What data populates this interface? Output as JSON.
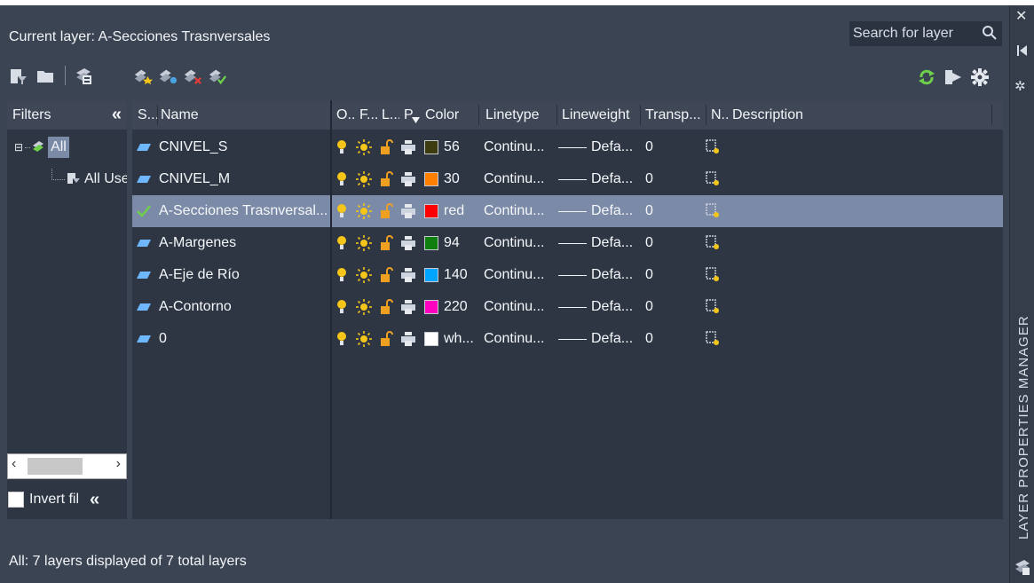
{
  "window": {
    "title": "LAYER PROPERTIES MANAGER",
    "current_layer_label": "Current layer: A-Secciones Trasnversales",
    "search_placeholder": "Search for layer"
  },
  "toolbar": {
    "left_icons": [
      "new-property-filter-icon",
      "new-group-filter-icon",
      "layer-states-manager-icon"
    ],
    "layer_icons": [
      "new-layer-icon",
      "new-layer-vp-frozen-icon",
      "delete-layer-icon",
      "set-current-icon"
    ],
    "right_icons": [
      "refresh-icon",
      "layer-settings-transfer-icon",
      "settings-gear-icon"
    ]
  },
  "filters": {
    "header": "Filters",
    "collapse_glyph": "«",
    "tree": [
      {
        "label": "All",
        "expand_glyph": "⊟",
        "selected": true
      },
      {
        "label": "All Used Layers"
      }
    ],
    "invert_label": "Invert fil",
    "invert_collapse": "«",
    "scroll_left": "‹",
    "scroll_right": "›"
  },
  "grid": {
    "columns": {
      "status": "S...",
      "name": "Name",
      "on": "O..",
      "freeze": "F...",
      "lock": "L...",
      "plot": "P",
      "color": "Color",
      "linetype": "Linetype",
      "lineweight": "Lineweight",
      "transparency": "Transp...",
      "new_vp_freeze": "N..",
      "description": "Description"
    },
    "rows": [
      {
        "name": "CNIVEL_S",
        "current": false,
        "color_label": "56",
        "color_hex": "#3c3c0e",
        "linetype": "Continu...",
        "lineweight": "Defa...",
        "transparency": "0"
      },
      {
        "name": "CNIVEL_M",
        "current": false,
        "color_label": "30",
        "color_hex": "#ff7f00",
        "linetype": "Continu...",
        "lineweight": "Defa...",
        "transparency": "0"
      },
      {
        "name": "A-Secciones Trasnversal...",
        "current": true,
        "color_label": "red",
        "color_hex": "#ff0000",
        "linetype": "Continu...",
        "lineweight": "Defa...",
        "transparency": "0"
      },
      {
        "name": "A-Margenes",
        "current": false,
        "color_label": "94",
        "color_hex": "#0f7f0f",
        "linetype": "Continu...",
        "lineweight": "Defa...",
        "transparency": "0"
      },
      {
        "name": "A-Eje de Río",
        "current": false,
        "color_label": "140",
        "color_hex": "#00a5ff",
        "linetype": "Continu...",
        "lineweight": "Defa...",
        "transparency": "0"
      },
      {
        "name": "A-Contorno",
        "current": false,
        "color_label": "220",
        "color_hex": "#ff00bf",
        "linetype": "Continu...",
        "lineweight": "Defa...",
        "transparency": "0"
      },
      {
        "name": "0",
        "current": false,
        "color_label": "wh...",
        "color_hex": "#ffffff",
        "linetype": "Continu...",
        "lineweight": "Defa...",
        "transparency": "0"
      }
    ]
  },
  "status_bar": {
    "text": "All: 7 layers displayed of 7 total layers"
  },
  "colors": {
    "panel_bg": "#3b4453",
    "grid_bg": "#2e3643",
    "header_bg": "#3f4756",
    "selected_row": "#7b8aa6",
    "accent_green": "#6ed04a",
    "bulb_yellow": "#f5c518",
    "lock_orange": "#f0a020"
  }
}
